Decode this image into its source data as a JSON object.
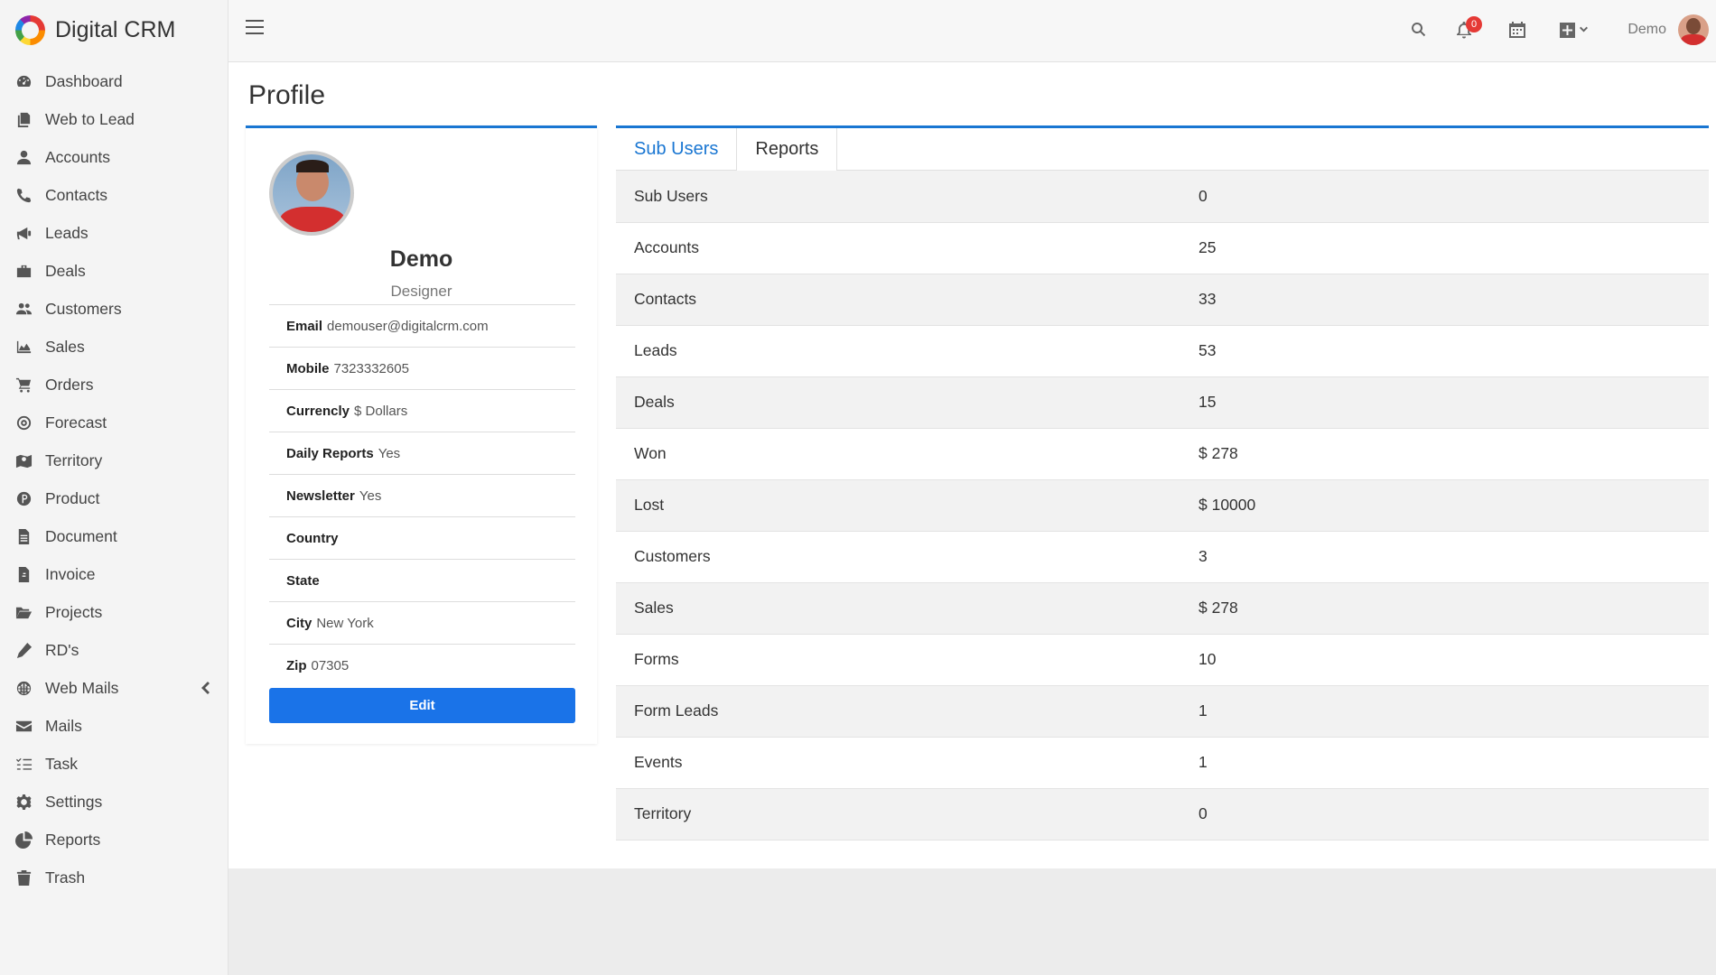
{
  "brand": {
    "name": "Digital CRM"
  },
  "sidebar": {
    "items": [
      {
        "label": "Dashboard",
        "icon": "dashboard-icon"
      },
      {
        "label": "Web to Lead",
        "icon": "copy-icon"
      },
      {
        "label": "Accounts",
        "icon": "user-icon"
      },
      {
        "label": "Contacts",
        "icon": "phone-icon"
      },
      {
        "label": "Leads",
        "icon": "bullhorn-icon"
      },
      {
        "label": "Deals",
        "icon": "briefcase-icon"
      },
      {
        "label": "Customers",
        "icon": "users-icon"
      },
      {
        "label": "Sales",
        "icon": "area-chart-icon"
      },
      {
        "label": "Orders",
        "icon": "cart-icon"
      },
      {
        "label": "Forecast",
        "icon": "target-icon"
      },
      {
        "label": "Territory",
        "icon": "map-icon"
      },
      {
        "label": "Product",
        "icon": "product-icon"
      },
      {
        "label": "Document",
        "icon": "document-icon"
      },
      {
        "label": "Invoice",
        "icon": "invoice-icon"
      },
      {
        "label": "Projects",
        "icon": "folder-open-icon"
      },
      {
        "label": "RD's",
        "icon": "pencil-icon"
      },
      {
        "label": "Web Mails",
        "icon": "globe-icon"
      },
      {
        "label": "Mails",
        "icon": "envelope-icon"
      },
      {
        "label": "Task",
        "icon": "tasks-icon"
      },
      {
        "label": "Settings",
        "icon": "gear-icon"
      },
      {
        "label": "Reports",
        "icon": "pie-chart-icon"
      },
      {
        "label": "Trash",
        "icon": "trash-icon"
      }
    ]
  },
  "topbar": {
    "notifications_count": "0",
    "user_name": "Demo"
  },
  "page": {
    "title": "Profile"
  },
  "profile": {
    "name": "Demo",
    "role": "Designer",
    "fields": [
      {
        "label": "Email",
        "value": "demouser@digitalcrm.com"
      },
      {
        "label": "Mobile",
        "value": "7323332605"
      },
      {
        "label": "Currencly",
        "value": "$ Dollars"
      },
      {
        "label": "Daily Reports",
        "value": "Yes"
      },
      {
        "label": "Newsletter",
        "value": "Yes"
      },
      {
        "label": "Country",
        "value": ""
      },
      {
        "label": "State",
        "value": ""
      },
      {
        "label": "City",
        "value": "New York"
      },
      {
        "label": "Zip",
        "value": "07305"
      }
    ],
    "edit_label": "Edit"
  },
  "tabs": [
    {
      "label": "Sub Users",
      "active": false
    },
    {
      "label": "Reports",
      "active": true
    }
  ],
  "report_rows": [
    {
      "label": "Sub Users",
      "value": "0"
    },
    {
      "label": "Accounts",
      "value": "25"
    },
    {
      "label": "Contacts",
      "value": "33"
    },
    {
      "label": "Leads",
      "value": "53"
    },
    {
      "label": "Deals",
      "value": "15"
    },
    {
      "label": "Won",
      "value": "$ 278"
    },
    {
      "label": "Lost",
      "value": "$ 10000"
    },
    {
      "label": "Customers",
      "value": "3"
    },
    {
      "label": "Sales",
      "value": "$ 278"
    },
    {
      "label": "Forms",
      "value": "10"
    },
    {
      "label": "Form Leads",
      "value": "1"
    },
    {
      "label": "Events",
      "value": "1"
    },
    {
      "label": "Territory",
      "value": "0"
    }
  ],
  "colors": {
    "accent": "#1976d2",
    "button": "#1a73e8",
    "badge": "#e53935"
  }
}
